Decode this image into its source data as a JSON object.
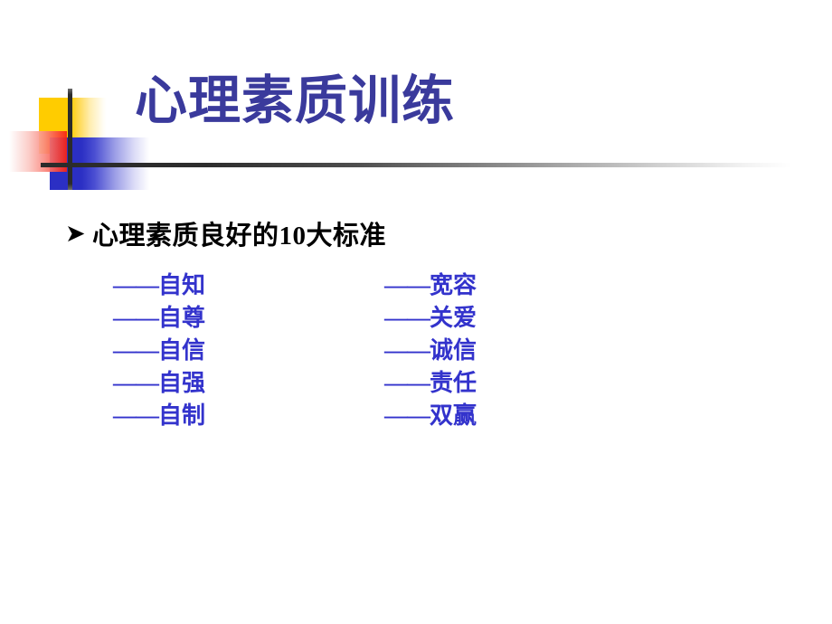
{
  "slide": {
    "title": "心理素质训练",
    "title_color": "#3a3a9c",
    "background_color": "#ffffff"
  },
  "decoration": {
    "name": "powerpoint-design-corner-graphic",
    "yellow_block_color": "#ffcc00",
    "blue_block_color": "#2b2fc4",
    "red_block_color": "#f82010",
    "rule_color": "#2b2b2b"
  },
  "bullet": {
    "marker": "➤",
    "text": "心理素质良好的10大标准",
    "color": "#000000"
  },
  "standards": {
    "dash": "——",
    "color": "#3333cc",
    "left_column": [
      "自知",
      "自尊",
      "自信",
      "自强",
      "自制"
    ],
    "right_column": [
      "宽容",
      "关爱",
      "诚信",
      "责任",
      "双赢"
    ]
  }
}
